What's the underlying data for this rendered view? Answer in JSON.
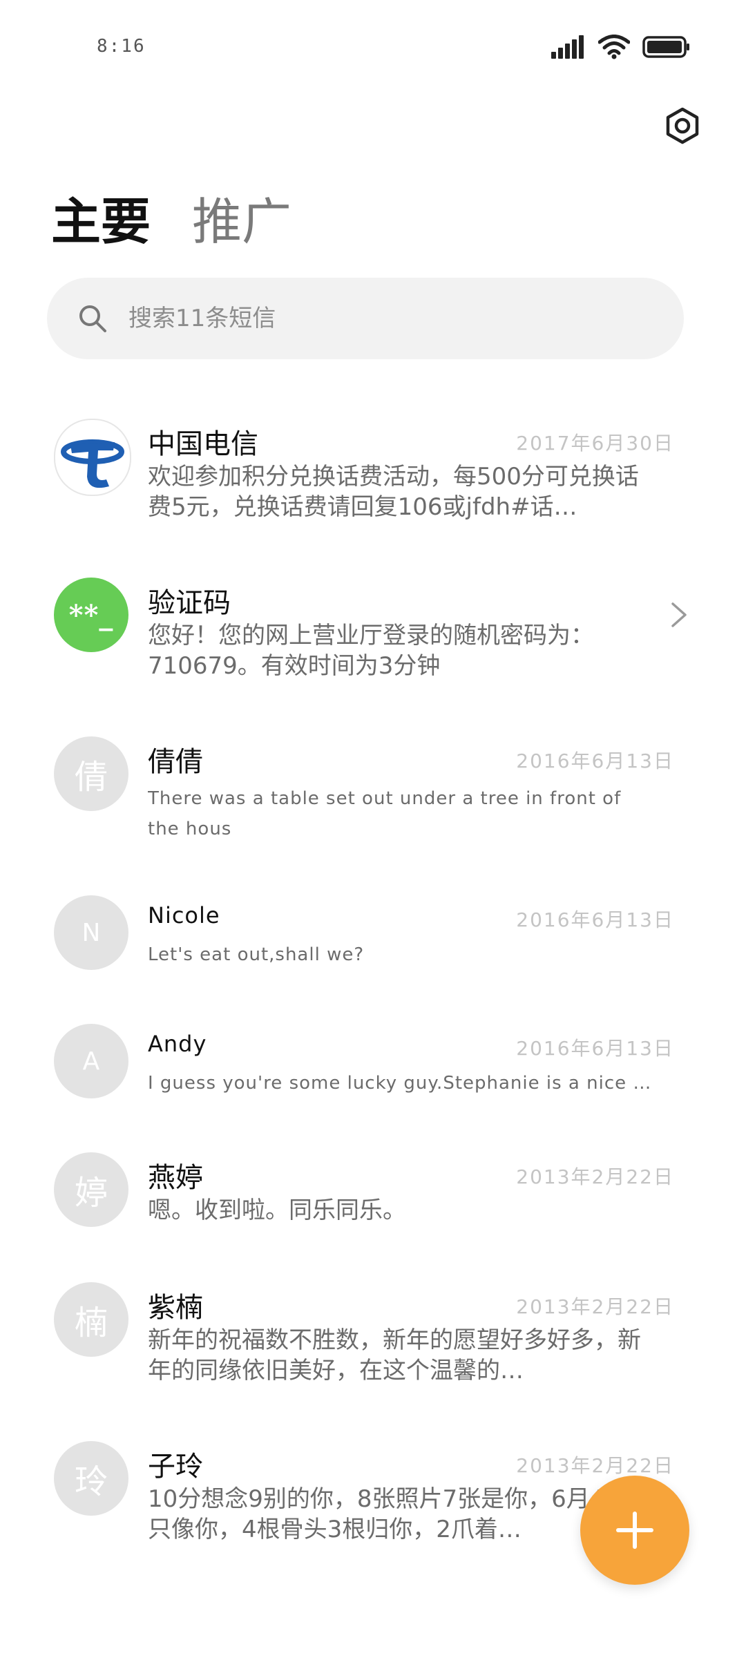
{
  "status_bar": {
    "time": "8:16",
    "icons": [
      "signal-icon",
      "wifi-icon",
      "battery-icon"
    ]
  },
  "header": {
    "settings_icon": "gear-icon",
    "tabs": [
      {
        "label": "主要",
        "active": true
      },
      {
        "label": "推广",
        "active": false
      }
    ]
  },
  "search": {
    "placeholder": "搜索11条短信"
  },
  "conversations": [
    {
      "name": "中国电信",
      "date": "2017年6月30日",
      "preview": "欢迎参加积分兑换话费活动，每500分可兑换话费5元，兑换话费请回复106或jfdh#话…",
      "avatar_text": "",
      "avatar_icon": "china-telecom-logo"
    },
    {
      "name": "验证码",
      "date": "",
      "preview": "您好！您的网上营业厅登录的随机密码为：710679。有效时间为3分钟",
      "avatar_text": "**_",
      "avatar_color": "#66cc55"
    },
    {
      "name": "倩倩",
      "date": "2016年6月13日",
      "preview": "There was a table set out under a tree in front of the hous",
      "avatar_text": "倩"
    },
    {
      "name": "Nicole",
      "date": "2016年6月13日",
      "preview": "Let's eat out,shall we?",
      "avatar_text": "N"
    },
    {
      "name": "Andy",
      "date": "2016年6月13日",
      "preview": "I guess you're some lucky guy.Stephanie is a nice girl.",
      "avatar_text": "A"
    },
    {
      "name": "燕婷",
      "date": "2013年2月22日",
      "preview": "嗯。收到啦。同乐同乐。",
      "avatar_text": "婷"
    },
    {
      "name": "紫楠",
      "date": "2013年2月22日",
      "preview": "新年的祝福数不胜数，新年的愿望好多好多，新年的同缘依旧美好，在这个温馨的…",
      "avatar_text": "楠"
    },
    {
      "name": "子玲",
      "date": "2013年2月22日",
      "preview": "10分想念9别的你，8张照片7张是你，6月4烟5只像你，4根骨头3根归你，2爪着…",
      "avatar_text": "玲"
    }
  ],
  "fab": {
    "icon": "plus-icon",
    "color": "#f7a43a"
  }
}
